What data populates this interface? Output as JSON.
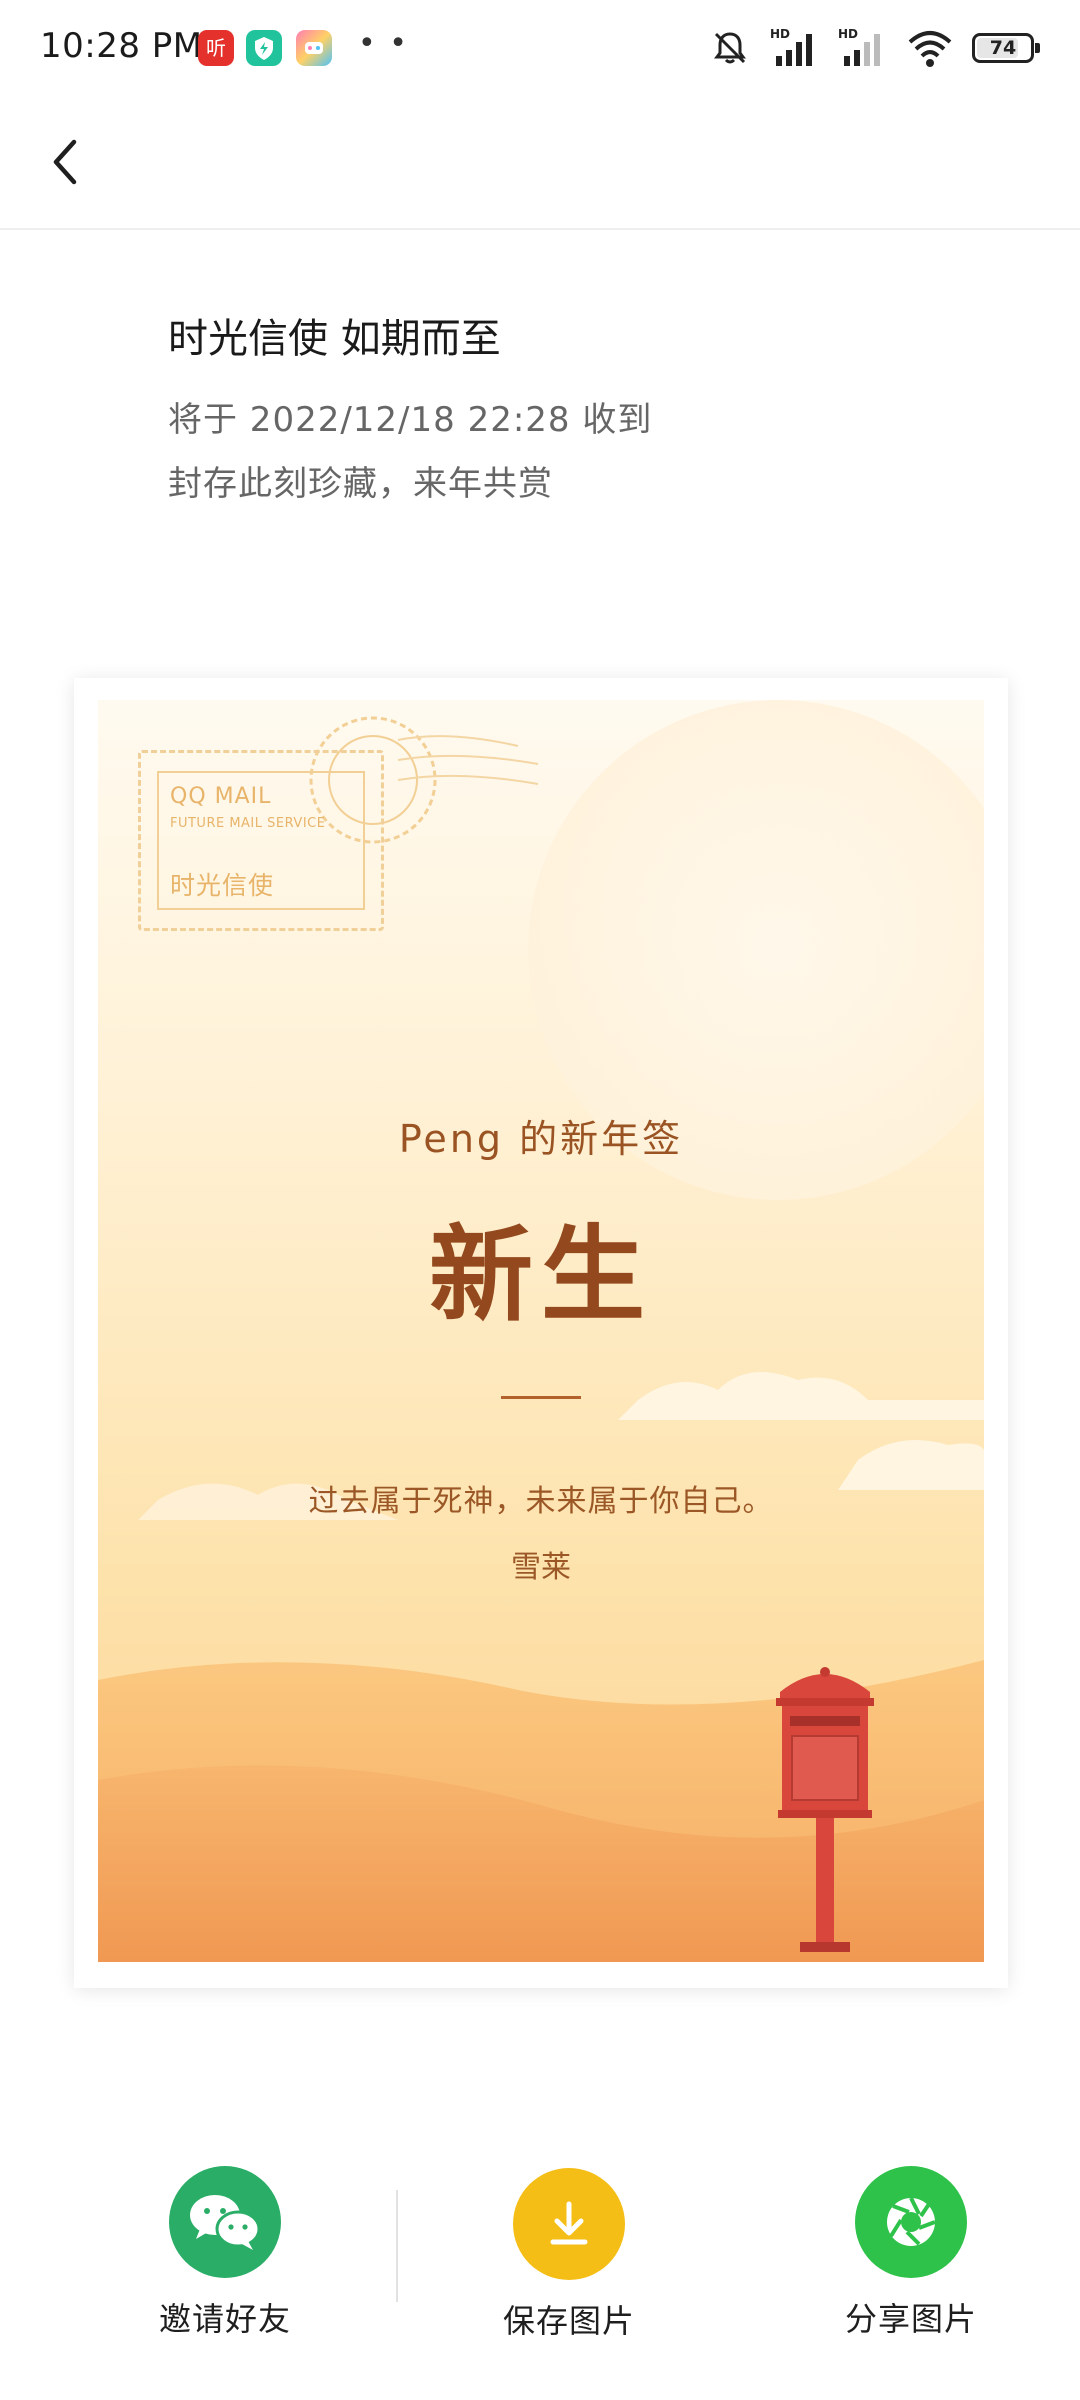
{
  "status_bar": {
    "time": "10:28 PM",
    "battery": "74",
    "battery_level": 0.74,
    "app_icons": [
      "red-ting-app-icon",
      "teal-shield-app-icon",
      "colorful-game-app-icon"
    ],
    "indicators": [
      "mute-icon",
      "hd-signal-icon",
      "hd-signal-icon",
      "wifi-icon",
      "battery-icon"
    ]
  },
  "nav": {
    "back_icon": "back-chevron-icon"
  },
  "header": {
    "title": "时光信使 如期而至",
    "subtitle_1": "将于 2022/12/18 22:28 收到",
    "subtitle_2": "封存此刻珍藏，来年共赏"
  },
  "card": {
    "stamp": {
      "brand": "QQ MAIL",
      "tagline": "FUTURE MAIL SERVICE",
      "name": "时光信使"
    },
    "heading": "Peng 的新年签",
    "big_text": "新生",
    "quote": "过去属于死神，未来属于你自己。",
    "author": "雪莱",
    "colors": {
      "sky_top": "#fff6e3",
      "sky_bottom": "#fdd7a0",
      "dune": "#f2a862",
      "text": "#93491d",
      "mailbox": "#d9473c"
    }
  },
  "actions": [
    {
      "label": "邀请好友",
      "icon": "wechat-icon",
      "color": "#2aae67"
    },
    {
      "label": "保存图片",
      "icon": "download-icon",
      "color": "#f5be16"
    },
    {
      "label": "分享图片",
      "icon": "aperture-icon",
      "color": "#2fc24a"
    }
  ]
}
